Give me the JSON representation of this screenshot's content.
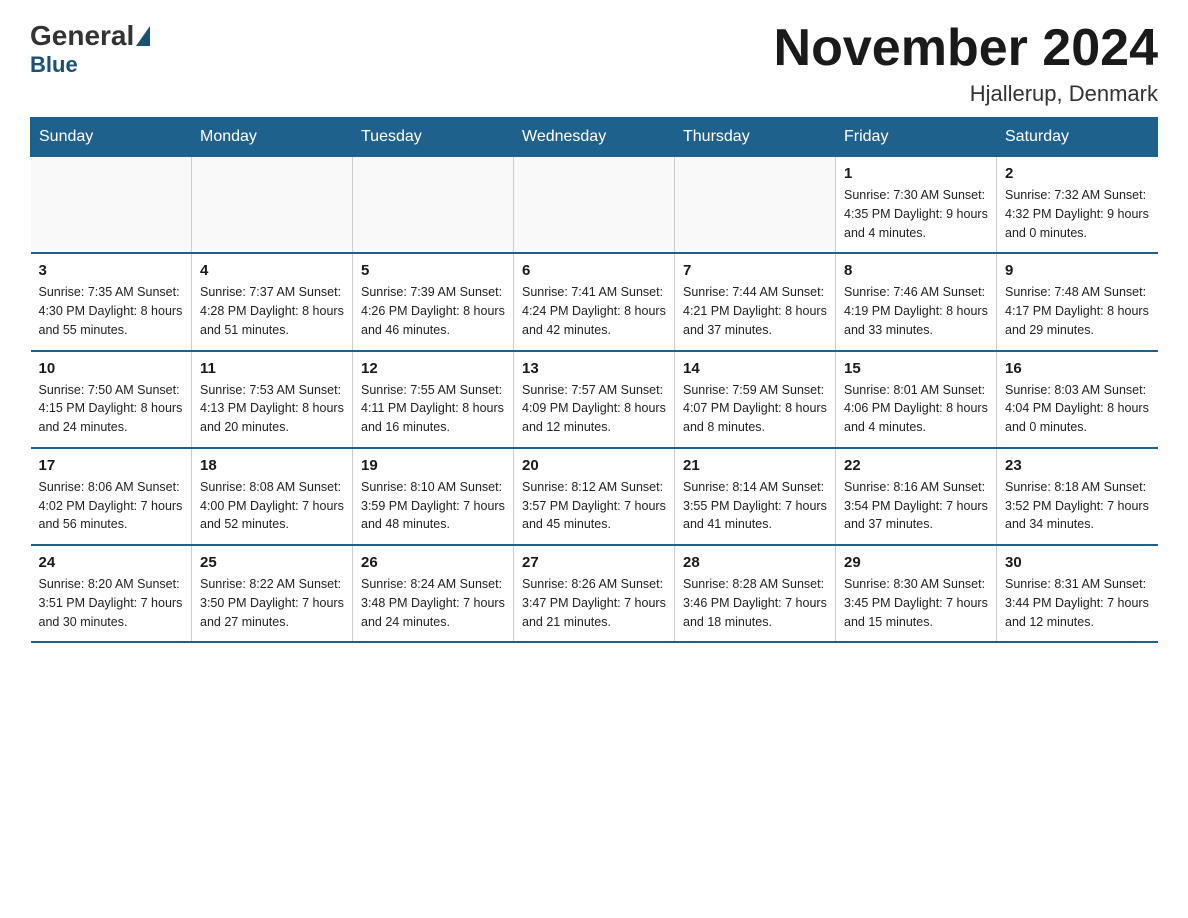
{
  "logo": {
    "general": "General",
    "blue": "Blue"
  },
  "title": "November 2024",
  "subtitle": "Hjallerup, Denmark",
  "weekdays": [
    "Sunday",
    "Monday",
    "Tuesday",
    "Wednesday",
    "Thursday",
    "Friday",
    "Saturday"
  ],
  "weeks": [
    [
      {
        "day": "",
        "info": ""
      },
      {
        "day": "",
        "info": ""
      },
      {
        "day": "",
        "info": ""
      },
      {
        "day": "",
        "info": ""
      },
      {
        "day": "",
        "info": ""
      },
      {
        "day": "1",
        "info": "Sunrise: 7:30 AM\nSunset: 4:35 PM\nDaylight: 9 hours\nand 4 minutes."
      },
      {
        "day": "2",
        "info": "Sunrise: 7:32 AM\nSunset: 4:32 PM\nDaylight: 9 hours\nand 0 minutes."
      }
    ],
    [
      {
        "day": "3",
        "info": "Sunrise: 7:35 AM\nSunset: 4:30 PM\nDaylight: 8 hours\nand 55 minutes."
      },
      {
        "day": "4",
        "info": "Sunrise: 7:37 AM\nSunset: 4:28 PM\nDaylight: 8 hours\nand 51 minutes."
      },
      {
        "day": "5",
        "info": "Sunrise: 7:39 AM\nSunset: 4:26 PM\nDaylight: 8 hours\nand 46 minutes."
      },
      {
        "day": "6",
        "info": "Sunrise: 7:41 AM\nSunset: 4:24 PM\nDaylight: 8 hours\nand 42 minutes."
      },
      {
        "day": "7",
        "info": "Sunrise: 7:44 AM\nSunset: 4:21 PM\nDaylight: 8 hours\nand 37 minutes."
      },
      {
        "day": "8",
        "info": "Sunrise: 7:46 AM\nSunset: 4:19 PM\nDaylight: 8 hours\nand 33 minutes."
      },
      {
        "day": "9",
        "info": "Sunrise: 7:48 AM\nSunset: 4:17 PM\nDaylight: 8 hours\nand 29 minutes."
      }
    ],
    [
      {
        "day": "10",
        "info": "Sunrise: 7:50 AM\nSunset: 4:15 PM\nDaylight: 8 hours\nand 24 minutes."
      },
      {
        "day": "11",
        "info": "Sunrise: 7:53 AM\nSunset: 4:13 PM\nDaylight: 8 hours\nand 20 minutes."
      },
      {
        "day": "12",
        "info": "Sunrise: 7:55 AM\nSunset: 4:11 PM\nDaylight: 8 hours\nand 16 minutes."
      },
      {
        "day": "13",
        "info": "Sunrise: 7:57 AM\nSunset: 4:09 PM\nDaylight: 8 hours\nand 12 minutes."
      },
      {
        "day": "14",
        "info": "Sunrise: 7:59 AM\nSunset: 4:07 PM\nDaylight: 8 hours\nand 8 minutes."
      },
      {
        "day": "15",
        "info": "Sunrise: 8:01 AM\nSunset: 4:06 PM\nDaylight: 8 hours\nand 4 minutes."
      },
      {
        "day": "16",
        "info": "Sunrise: 8:03 AM\nSunset: 4:04 PM\nDaylight: 8 hours\nand 0 minutes."
      }
    ],
    [
      {
        "day": "17",
        "info": "Sunrise: 8:06 AM\nSunset: 4:02 PM\nDaylight: 7 hours\nand 56 minutes."
      },
      {
        "day": "18",
        "info": "Sunrise: 8:08 AM\nSunset: 4:00 PM\nDaylight: 7 hours\nand 52 minutes."
      },
      {
        "day": "19",
        "info": "Sunrise: 8:10 AM\nSunset: 3:59 PM\nDaylight: 7 hours\nand 48 minutes."
      },
      {
        "day": "20",
        "info": "Sunrise: 8:12 AM\nSunset: 3:57 PM\nDaylight: 7 hours\nand 45 minutes."
      },
      {
        "day": "21",
        "info": "Sunrise: 8:14 AM\nSunset: 3:55 PM\nDaylight: 7 hours\nand 41 minutes."
      },
      {
        "day": "22",
        "info": "Sunrise: 8:16 AM\nSunset: 3:54 PM\nDaylight: 7 hours\nand 37 minutes."
      },
      {
        "day": "23",
        "info": "Sunrise: 8:18 AM\nSunset: 3:52 PM\nDaylight: 7 hours\nand 34 minutes."
      }
    ],
    [
      {
        "day": "24",
        "info": "Sunrise: 8:20 AM\nSunset: 3:51 PM\nDaylight: 7 hours\nand 30 minutes."
      },
      {
        "day": "25",
        "info": "Sunrise: 8:22 AM\nSunset: 3:50 PM\nDaylight: 7 hours\nand 27 minutes."
      },
      {
        "day": "26",
        "info": "Sunrise: 8:24 AM\nSunset: 3:48 PM\nDaylight: 7 hours\nand 24 minutes."
      },
      {
        "day": "27",
        "info": "Sunrise: 8:26 AM\nSunset: 3:47 PM\nDaylight: 7 hours\nand 21 minutes."
      },
      {
        "day": "28",
        "info": "Sunrise: 8:28 AM\nSunset: 3:46 PM\nDaylight: 7 hours\nand 18 minutes."
      },
      {
        "day": "29",
        "info": "Sunrise: 8:30 AM\nSunset: 3:45 PM\nDaylight: 7 hours\nand 15 minutes."
      },
      {
        "day": "30",
        "info": "Sunrise: 8:31 AM\nSunset: 3:44 PM\nDaylight: 7 hours\nand 12 minutes."
      }
    ]
  ]
}
